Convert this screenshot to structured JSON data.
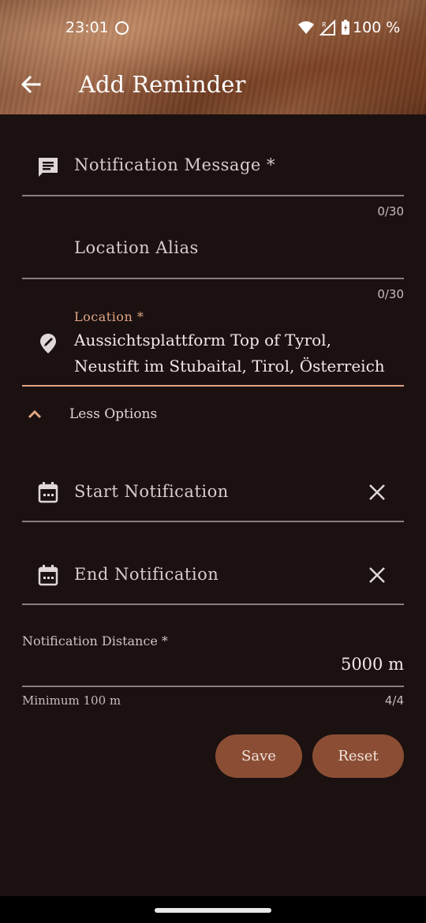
{
  "status_bar": {
    "time": "23:01",
    "battery": "100 %"
  },
  "app_bar": {
    "title": "Add Reminder",
    "back_icon": "arrow-back-icon"
  },
  "form": {
    "notification_message": {
      "placeholder": "Notification Message *",
      "counter": "0/30",
      "icon": "message-icon"
    },
    "location_alias": {
      "placeholder": "Location Alias",
      "counter": "0/30"
    },
    "location": {
      "label": "Location *",
      "value_line1": "Aussichtsplattform Top of Tyrol,",
      "value_line2": "Neustift im Stubaital, Tirol, Österreich",
      "icon": "location-edit-icon"
    },
    "toggle_options": {
      "label": "Less Options",
      "icon": "chevron-up-icon"
    },
    "start_notification": {
      "placeholder": "Start Notification",
      "icon": "calendar-icon"
    },
    "end_notification": {
      "placeholder": "End Notification",
      "icon": "calendar-icon"
    },
    "notification_distance": {
      "label": "Notification Distance *",
      "value": "5000 m",
      "helper": "Minimum 100 m",
      "counter": "4/4"
    }
  },
  "actions": {
    "save_label": "Save",
    "reset_label": "Reset"
  },
  "colors": {
    "background": "#1b1111",
    "accent": "#e0a585",
    "button": "#8b4e34"
  }
}
